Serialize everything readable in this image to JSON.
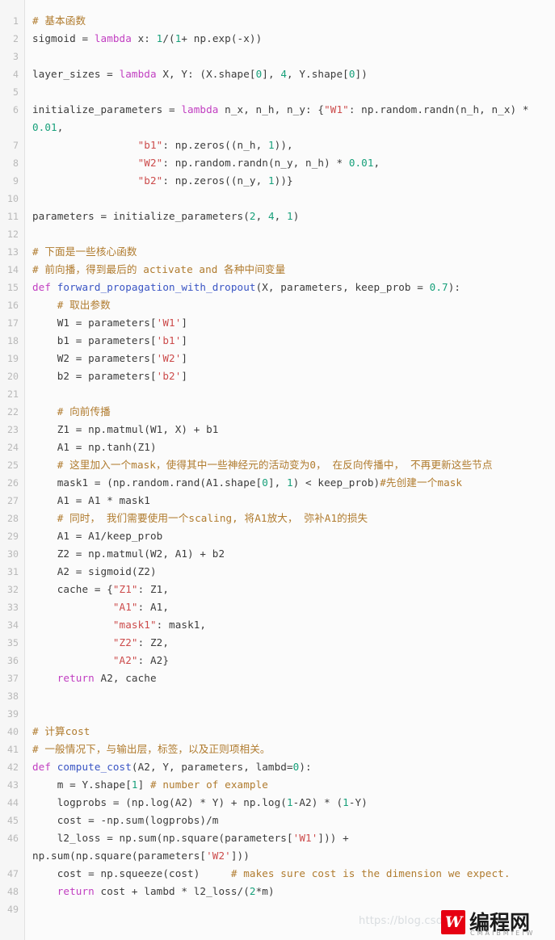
{
  "editor": {
    "language": "python",
    "background_color": "#fbfbfb",
    "gutter_color": "#f6f6f6",
    "first_line_number": 1,
    "last_line_number": 49,
    "colors": {
      "comment": "#b07b2e",
      "keyword": "#c13ec1",
      "function": "#3a55c4",
      "string": "#cc4b4b",
      "number": "#17a07a",
      "plain": "#3b3b3b",
      "line_number": "#b9b9b9"
    }
  },
  "lines": [
    {
      "n": "1",
      "tokens": [
        {
          "t": "com",
          "s": "# 基本函数"
        }
      ]
    },
    {
      "n": "2",
      "tokens": [
        {
          "t": "pln",
          "s": "sigmoid = "
        },
        {
          "t": "kw",
          "s": "lambda"
        },
        {
          "t": "pln",
          "s": " x: "
        },
        {
          "t": "num",
          "s": "1"
        },
        {
          "t": "pln",
          "s": "/("
        },
        {
          "t": "num",
          "s": "1"
        },
        {
          "t": "pln",
          "s": "+ np.exp(-x))"
        }
      ]
    },
    {
      "n": "3",
      "tokens": []
    },
    {
      "n": "4",
      "tokens": [
        {
          "t": "pln",
          "s": "layer_sizes = "
        },
        {
          "t": "kw",
          "s": "lambda"
        },
        {
          "t": "pln",
          "s": " X, Y: (X.shape["
        },
        {
          "t": "num",
          "s": "0"
        },
        {
          "t": "pln",
          "s": "], "
        },
        {
          "t": "num",
          "s": "4"
        },
        {
          "t": "pln",
          "s": ", Y.shape["
        },
        {
          "t": "num",
          "s": "0"
        },
        {
          "t": "pln",
          "s": "])"
        }
      ]
    },
    {
      "n": "5",
      "tokens": []
    },
    {
      "n": "6",
      "tokens": [
        {
          "t": "pln",
          "s": "initialize_parameters = "
        },
        {
          "t": "kw",
          "s": "lambda"
        },
        {
          "t": "pln",
          "s": " n_x, n_h, n_y: {"
        },
        {
          "t": "str",
          "s": "\"W1\""
        },
        {
          "t": "pln",
          "s": ": np.random.randn(n_h, n_x) * "
        },
        {
          "t": "num",
          "s": "0.01"
        },
        {
          "t": "pln",
          "s": ","
        }
      ]
    },
    {
      "n": "7",
      "tokens": [
        {
          "t": "pln",
          "s": "                 "
        },
        {
          "t": "str",
          "s": "\"b1\""
        },
        {
          "t": "pln",
          "s": ": np.zeros((n_h, "
        },
        {
          "t": "num",
          "s": "1"
        },
        {
          "t": "pln",
          "s": ")),"
        }
      ]
    },
    {
      "n": "8",
      "tokens": [
        {
          "t": "pln",
          "s": "                 "
        },
        {
          "t": "str",
          "s": "\"W2\""
        },
        {
          "t": "pln",
          "s": ": np.random.randn(n_y, n_h) * "
        },
        {
          "t": "num",
          "s": "0.01"
        },
        {
          "t": "pln",
          "s": ","
        }
      ]
    },
    {
      "n": "9",
      "tokens": [
        {
          "t": "pln",
          "s": "                 "
        },
        {
          "t": "str",
          "s": "\"b2\""
        },
        {
          "t": "pln",
          "s": ": np.zeros((n_y, "
        },
        {
          "t": "num",
          "s": "1"
        },
        {
          "t": "pln",
          "s": "))}"
        }
      ]
    },
    {
      "n": "10",
      "tokens": []
    },
    {
      "n": "11",
      "tokens": [
        {
          "t": "pln",
          "s": "parameters = initialize_parameters("
        },
        {
          "t": "num",
          "s": "2"
        },
        {
          "t": "pln",
          "s": ", "
        },
        {
          "t": "num",
          "s": "4"
        },
        {
          "t": "pln",
          "s": ", "
        },
        {
          "t": "num",
          "s": "1"
        },
        {
          "t": "pln",
          "s": ")"
        }
      ]
    },
    {
      "n": "12",
      "tokens": []
    },
    {
      "n": "13",
      "tokens": [
        {
          "t": "com",
          "s": "# 下面是一些核心函数"
        }
      ]
    },
    {
      "n": "14",
      "tokens": [
        {
          "t": "com",
          "s": "# 前向播，得到最后的 activate and 各种中间变量"
        }
      ]
    },
    {
      "n": "15",
      "tokens": [
        {
          "t": "kw",
          "s": "def"
        },
        {
          "t": "pln",
          "s": " "
        },
        {
          "t": "fn",
          "s": "forward_propagation_with_dropout"
        },
        {
          "t": "pln",
          "s": "(X, parameters, keep_prob = "
        },
        {
          "t": "num",
          "s": "0.7"
        },
        {
          "t": "pln",
          "s": "):"
        }
      ]
    },
    {
      "n": "16",
      "tokens": [
        {
          "t": "pln",
          "s": "    "
        },
        {
          "t": "com",
          "s": "# 取出参数"
        }
      ]
    },
    {
      "n": "17",
      "tokens": [
        {
          "t": "pln",
          "s": "    W1 = parameters["
        },
        {
          "t": "str",
          "s": "'W1'"
        },
        {
          "t": "pln",
          "s": "]"
        }
      ]
    },
    {
      "n": "18",
      "tokens": [
        {
          "t": "pln",
          "s": "    b1 = parameters["
        },
        {
          "t": "str",
          "s": "'b1'"
        },
        {
          "t": "pln",
          "s": "]"
        }
      ]
    },
    {
      "n": "19",
      "tokens": [
        {
          "t": "pln",
          "s": "    W2 = parameters["
        },
        {
          "t": "str",
          "s": "'W2'"
        },
        {
          "t": "pln",
          "s": "]"
        }
      ]
    },
    {
      "n": "20",
      "tokens": [
        {
          "t": "pln",
          "s": "    b2 = parameters["
        },
        {
          "t": "str",
          "s": "'b2'"
        },
        {
          "t": "pln",
          "s": "]"
        }
      ]
    },
    {
      "n": "21",
      "tokens": []
    },
    {
      "n": "22",
      "tokens": [
        {
          "t": "pln",
          "s": "    "
        },
        {
          "t": "com",
          "s": "# 向前传播"
        }
      ]
    },
    {
      "n": "23",
      "tokens": [
        {
          "t": "pln",
          "s": "    Z1 = np.matmul(W1, X) + b1"
        }
      ]
    },
    {
      "n": "24",
      "tokens": [
        {
          "t": "pln",
          "s": "    A1 = np.tanh(Z1)"
        }
      ]
    },
    {
      "n": "25",
      "tokens": [
        {
          "t": "pln",
          "s": "    "
        },
        {
          "t": "com",
          "s": "# 这里加入一个mask，使得其中一些神经元的活动变为0， 在反向传播中， 不再更新这些节点"
        }
      ]
    },
    {
      "n": "26",
      "tokens": [
        {
          "t": "pln",
          "s": "    mask1 = (np.random.rand(A1.shape["
        },
        {
          "t": "num",
          "s": "0"
        },
        {
          "t": "pln",
          "s": "], "
        },
        {
          "t": "num",
          "s": "1"
        },
        {
          "t": "pln",
          "s": ") < keep_prob)"
        },
        {
          "t": "com",
          "s": "#先创建一个mask"
        }
      ]
    },
    {
      "n": "27",
      "tokens": [
        {
          "t": "pln",
          "s": "    A1 = A1 * mask1"
        }
      ]
    },
    {
      "n": "28",
      "tokens": [
        {
          "t": "pln",
          "s": "    "
        },
        {
          "t": "com",
          "s": "# 同时， 我们需要使用一个scaling, 将A1放大， 弥补A1的损失"
        }
      ]
    },
    {
      "n": "29",
      "tokens": [
        {
          "t": "pln",
          "s": "    A1 = A1/keep_prob"
        }
      ]
    },
    {
      "n": "30",
      "tokens": [
        {
          "t": "pln",
          "s": "    Z2 = np.matmul(W2, A1) + b2"
        }
      ]
    },
    {
      "n": "31",
      "tokens": [
        {
          "t": "pln",
          "s": "    A2 = sigmoid(Z2)"
        }
      ]
    },
    {
      "n": "32",
      "tokens": [
        {
          "t": "pln",
          "s": "    cache = {"
        },
        {
          "t": "str",
          "s": "\"Z1\""
        },
        {
          "t": "pln",
          "s": ": Z1,"
        }
      ]
    },
    {
      "n": "33",
      "tokens": [
        {
          "t": "pln",
          "s": "             "
        },
        {
          "t": "str",
          "s": "\"A1\""
        },
        {
          "t": "pln",
          "s": ": A1,"
        }
      ]
    },
    {
      "n": "34",
      "tokens": [
        {
          "t": "pln",
          "s": "             "
        },
        {
          "t": "str",
          "s": "\"mask1\""
        },
        {
          "t": "pln",
          "s": ": mask1,"
        }
      ]
    },
    {
      "n": "35",
      "tokens": [
        {
          "t": "pln",
          "s": "             "
        },
        {
          "t": "str",
          "s": "\"Z2\""
        },
        {
          "t": "pln",
          "s": ": Z2,"
        }
      ]
    },
    {
      "n": "36",
      "tokens": [
        {
          "t": "pln",
          "s": "             "
        },
        {
          "t": "str",
          "s": "\"A2\""
        },
        {
          "t": "pln",
          "s": ": A2}"
        }
      ]
    },
    {
      "n": "37",
      "tokens": [
        {
          "t": "pln",
          "s": "    "
        },
        {
          "t": "kw",
          "s": "return"
        },
        {
          "t": "pln",
          "s": " A2, cache"
        }
      ]
    },
    {
      "n": "38",
      "tokens": []
    },
    {
      "n": "39",
      "tokens": []
    },
    {
      "n": "40",
      "tokens": [
        {
          "t": "com",
          "s": "# 计算cost"
        }
      ]
    },
    {
      "n": "41",
      "tokens": [
        {
          "t": "com",
          "s": "# 一般情况下，与输出层，标签，以及正则项相关。"
        }
      ]
    },
    {
      "n": "42",
      "tokens": [
        {
          "t": "kw",
          "s": "def"
        },
        {
          "t": "pln",
          "s": " "
        },
        {
          "t": "fn",
          "s": "compute_cost"
        },
        {
          "t": "pln",
          "s": "(A2, Y, parameters, lambd="
        },
        {
          "t": "num",
          "s": "0"
        },
        {
          "t": "pln",
          "s": "):"
        }
      ]
    },
    {
      "n": "43",
      "tokens": [
        {
          "t": "pln",
          "s": "    m = Y.shape["
        },
        {
          "t": "num",
          "s": "1"
        },
        {
          "t": "pln",
          "s": "] "
        },
        {
          "t": "com",
          "s": "# number of example"
        }
      ]
    },
    {
      "n": "44",
      "tokens": [
        {
          "t": "pln",
          "s": "    logprobs = (np.log(A2) * Y) + np.log("
        },
        {
          "t": "num",
          "s": "1"
        },
        {
          "t": "pln",
          "s": "-A2) * ("
        },
        {
          "t": "num",
          "s": "1"
        },
        {
          "t": "pln",
          "s": "-Y)"
        }
      ]
    },
    {
      "n": "45",
      "tokens": [
        {
          "t": "pln",
          "s": "    cost = -np.sum(logprobs)/m"
        }
      ]
    },
    {
      "n": "46",
      "tokens": [
        {
          "t": "pln",
          "s": "    l2_loss = np.sum(np.square(parameters["
        },
        {
          "t": "str",
          "s": "'W1'"
        },
        {
          "t": "pln",
          "s": "])) + np.sum(np.square(parameters["
        },
        {
          "t": "str",
          "s": "'W2'"
        },
        {
          "t": "pln",
          "s": "]))"
        }
      ]
    },
    {
      "n": "47",
      "tokens": [
        {
          "t": "pln",
          "s": "    cost = np.squeeze(cost)     "
        },
        {
          "t": "com",
          "s": "# makes sure cost is the dimension we expect."
        }
      ]
    },
    {
      "n": "48",
      "tokens": [
        {
          "t": "pln",
          "s": "    "
        },
        {
          "t": "kw",
          "s": "return"
        },
        {
          "t": "pln",
          "s": " cost + lambd * l2_loss/("
        },
        {
          "t": "num",
          "s": "2"
        },
        {
          "t": "pln",
          "s": "*m)"
        }
      ]
    },
    {
      "n": "49",
      "tokens": []
    }
  ],
  "watermarks": {
    "url": "https://blog.csdn",
    "brand_name": "编程网",
    "brand_mark_glyph": "W",
    "brand_subtitle": "CMAIBMIEIW",
    "brand_color": "#e60012"
  }
}
